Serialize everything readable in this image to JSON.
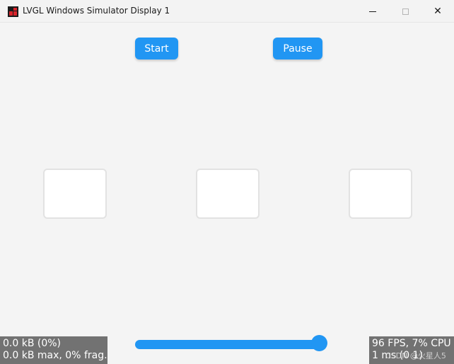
{
  "window": {
    "title": "LVGL Windows Simulator Display 1",
    "close_glyph": "✕"
  },
  "buttons": {
    "start_label": "Start",
    "pause_label": "Pause"
  },
  "slider": {
    "value_fraction": 1.0
  },
  "memory_monitor": {
    "line1": "0.0 kB (0%)",
    "line2": "0.0 kB max, 0% frag."
  },
  "performance_monitor": {
    "line1": "96 FPS, 7% CPU",
    "line2": "1 ms (0 1)"
  },
  "watermark": "CSDN @火星人5",
  "colors": {
    "accent": "#2196f3",
    "screen_bg": "#f4f4f4",
    "overlay_bg": "#646464"
  }
}
